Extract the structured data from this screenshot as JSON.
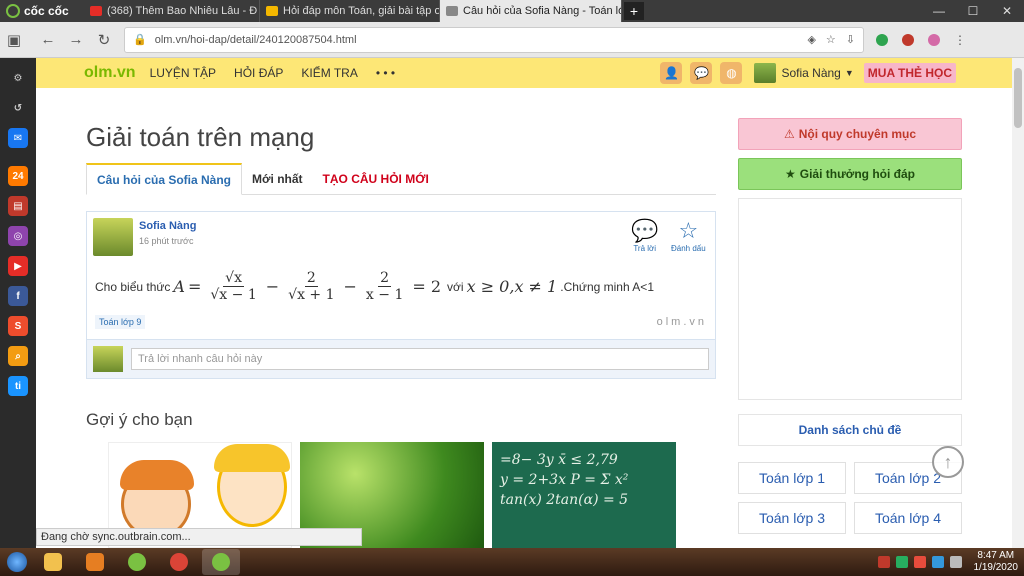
{
  "browser": {
    "brand": "cốc cốc",
    "tabs": [
      {
        "label": "(368) Thêm Bao Nhiêu Lâu - Đ",
        "color": "#e52d27",
        "active": false
      },
      {
        "label": "Hỏi đáp môn Toán, giải bài tập on",
        "color": "#f5b800",
        "active": false
      },
      {
        "label": "Câu hỏi của Sofia Nàng - Toán lớp",
        "color": "#888888",
        "active": true
      }
    ],
    "url": "olm.vn/hoi-dap/detail/240120087504.html"
  },
  "site": {
    "logo": "olm.vn",
    "nav": [
      "LUYỆN TẬP",
      "HỎI ĐÁP",
      "KIỂM TRA",
      "• • •"
    ],
    "username": "Sofia Nàng",
    "buy_label": "MUA THẺ HỌC"
  },
  "main": {
    "title": "Giải toán trên mạng",
    "tabs": [
      {
        "label": "Câu hỏi của Sofia Nàng"
      },
      {
        "label": "Mới nhất"
      },
      {
        "label": "TẠO CÂU HỎI MỚI"
      }
    ],
    "question": {
      "author": "Sofia Nàng",
      "time": "16 phút trước",
      "reply_label": "Trả lời",
      "bookmark_label": "Đánh dấu",
      "text_prefix": "Cho biểu thức",
      "text_mid": "với",
      "text_suffix": ".Chứng minh A<1",
      "tag": "Toán lớp 9",
      "watermark": "olm.vn",
      "quick_reply_placeholder": "Trả lời nhanh câu hỏi này"
    },
    "suggest_title": "Gợi ý cho bạn"
  },
  "right": {
    "rules_label": "Nội quy chuyên mục",
    "prize_label": "Giải thưởng hỏi đáp",
    "topics_label": "Danh sách chủ đề",
    "grades": [
      "Toán lớp 1",
      "Toán lớp 2",
      "Toán lớp 3",
      "Toán lớp 4"
    ]
  },
  "status_text": "Đang chờ sync.outbrain.com...",
  "clock": {
    "time": "8:47 AM",
    "date": "1/19/2020"
  }
}
